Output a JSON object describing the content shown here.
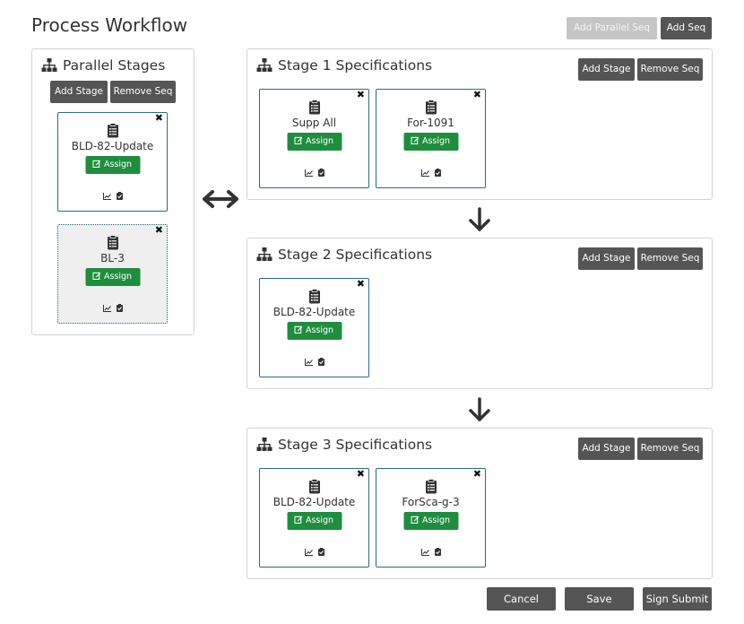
{
  "page": {
    "title": "Process Workflow"
  },
  "toolbar": {
    "add_parallel_seq": "Add Parallel Seq",
    "add_seq": "Add Seq"
  },
  "panel_buttons": {
    "add_stage": "Add Stage",
    "remove_seq": "Remove Seq"
  },
  "card_assign_label": "Assign",
  "parallel": {
    "title": "Parallel Stages",
    "cards": [
      {
        "name": "BLD-82-Update"
      },
      {
        "name": "BL-3"
      }
    ]
  },
  "stages": [
    {
      "title": "Stage 1 Specifications",
      "cards": [
        {
          "name": "Supp All"
        },
        {
          "name": "For-1091"
        }
      ]
    },
    {
      "title": "Stage 2 Specifications",
      "cards": [
        {
          "name": "BLD-82-Update"
        }
      ]
    },
    {
      "title": "Stage 3 Specifications",
      "cards": [
        {
          "name": "BLD-82-Update"
        },
        {
          "name": "ForSca-g-3"
        }
      ]
    }
  ],
  "footer": {
    "cancel": "Cancel",
    "save": "Save",
    "sign_submit": "Sign Submit"
  },
  "icons": {
    "sitemap": "sitemap-icon",
    "clipboard": "clipboard-icon",
    "edit": "edit-icon",
    "chart": "line-chart-icon",
    "check": "clipboard-check-icon",
    "close": "close-icon",
    "swap": "swap-horizontal-icon",
    "down": "arrow-down-icon"
  },
  "colors": {
    "assign_green": "#1e8e3e",
    "card_border": "#2a6b84",
    "button_dark": "#555555",
    "button_disabled": "#c6c6c6"
  }
}
